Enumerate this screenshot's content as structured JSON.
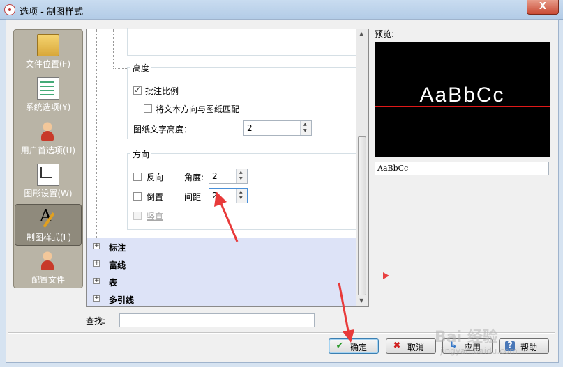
{
  "window": {
    "title": "选项 - 制图样式",
    "close_glyph": "X"
  },
  "nav": {
    "items": [
      {
        "label": "文件位置(F)",
        "icon": "folder-icon"
      },
      {
        "label": "系统选项(Y)",
        "icon": "list-icon"
      },
      {
        "label": "用户首选项(U)",
        "icon": "user-icon"
      },
      {
        "label": "图形设置(W)",
        "icon": "graphics-icon"
      },
      {
        "label": "制图样式(L)",
        "icon": "drafting-style-icon",
        "active": true
      },
      {
        "label": "配置文件",
        "icon": "profile-icon"
      }
    ]
  },
  "height_group": {
    "title": "高度",
    "annotation_scale_label": "批注比例",
    "annotation_scale_checked": true,
    "match_text_label": "将文本方向与图纸匹配",
    "match_text_checked": false,
    "sheet_text_height_label": "图纸文字高度：",
    "sheet_text_height_value": "2"
  },
  "direction_group": {
    "title": "方向",
    "reverse_label": "反向",
    "reverse_checked": false,
    "angle_label": "角度:",
    "angle_value": "2",
    "upside_down_label": "倒置",
    "upside_down_checked": false,
    "spacing_label": "间距",
    "spacing_value": "2",
    "vertical_label": "竖直",
    "vertical_disabled": true
  },
  "categories": [
    "标注",
    "富线",
    "表",
    "多引线"
  ],
  "preview": {
    "label": "预览:",
    "sample_text": "AaBbCc",
    "input_value": "AaBbCc"
  },
  "find": {
    "label": "查找:",
    "value": ""
  },
  "buttons": {
    "ok": "确定",
    "cancel": "取消",
    "apply": "应用",
    "help": "帮助"
  },
  "watermark": {
    "text": "Bai 经验",
    "sub": "jingyan.baidu.com"
  },
  "colors": {
    "accent_red": "#e84040",
    "category_bg": "#dde3f7",
    "preview_bg": "#000000"
  }
}
